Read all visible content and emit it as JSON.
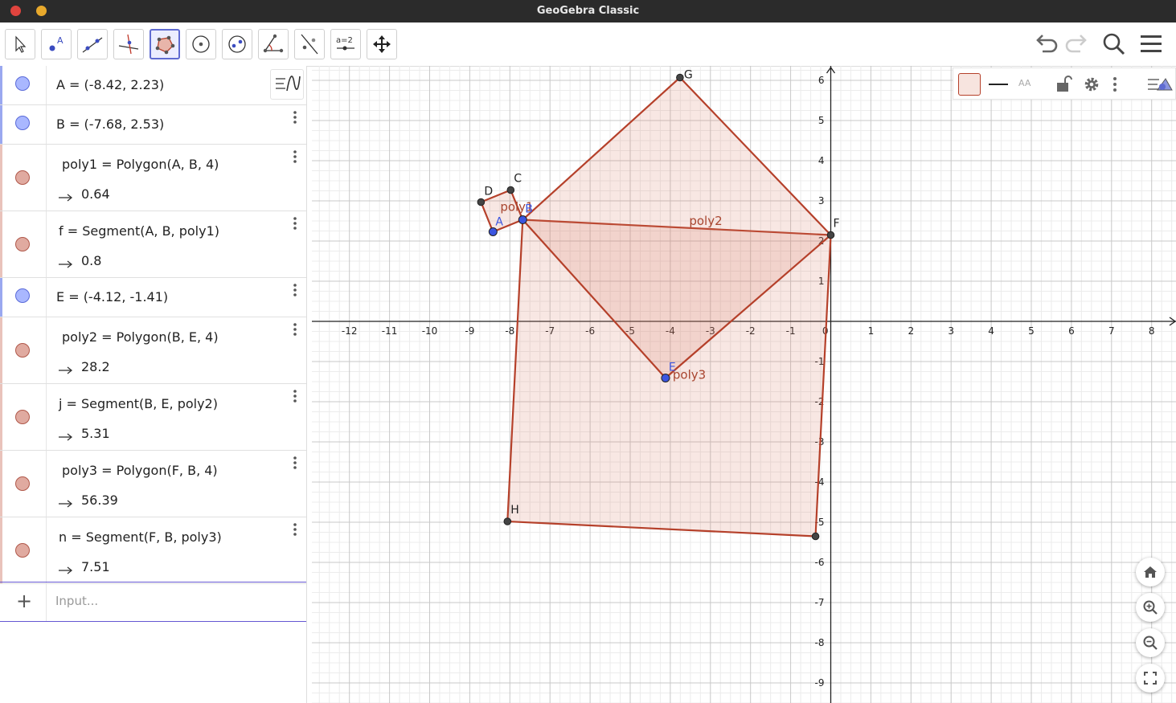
{
  "window": {
    "title": "GeoGebra Classic"
  },
  "toolbar": {
    "tools": [
      {
        "name": "move-tool",
        "selected": false
      },
      {
        "name": "point-tool",
        "selected": false
      },
      {
        "name": "line-tool",
        "selected": false
      },
      {
        "name": "perpendicular-line-tool",
        "selected": false
      },
      {
        "name": "polygon-tool",
        "selected": true
      },
      {
        "name": "circle-tool",
        "selected": false
      },
      {
        "name": "ellipse-tool",
        "selected": false
      },
      {
        "name": "angle-tool",
        "selected": false
      },
      {
        "name": "reflect-tool",
        "selected": false
      },
      {
        "name": "slider-tool",
        "selected": false
      },
      {
        "name": "move-graphics-tool",
        "selected": false
      }
    ],
    "slider_label": "a=2"
  },
  "algebra": {
    "items": [
      {
        "def": "A = (-8.42, 2.23)",
        "color": "blue"
      },
      {
        "def": "B = (-7.68, 2.53)",
        "color": "blue"
      },
      {
        "def": "poly1 = Polygon(A, B, 4)",
        "value": "0.64",
        "color": "red"
      },
      {
        "def": "f = Segment(A, B, poly1)",
        "value": "0.8",
        "color": "red"
      },
      {
        "def": "E = (-4.12, -1.41)",
        "color": "blue"
      },
      {
        "def": "poly2 = Polygon(B, E, 4)",
        "value": "28.2",
        "color": "red"
      },
      {
        "def": "j = Segment(B, E, poly2)",
        "value": "5.31",
        "color": "red"
      },
      {
        "def": "poly3 = Polygon(F, B, 4)",
        "value": "56.39",
        "color": "red"
      },
      {
        "def": "n = Segment(F, B, poly3)",
        "value": "7.51",
        "color": "red"
      }
    ],
    "input_placeholder": "Input..."
  },
  "graphics": {
    "x_ticks": [
      "-12",
      "-11",
      "-10",
      "-9",
      "-8",
      "-7",
      "-6",
      "-5",
      "-4",
      "-3",
      "-2",
      "-1",
      "0",
      "1",
      "2",
      "3",
      "4",
      "5",
      "6",
      "7",
      "8"
    ],
    "y_ticks": [
      "6",
      "5",
      "4",
      "3",
      "2",
      "1",
      "-1",
      "-2",
      "-3",
      "-4",
      "-5",
      "-6",
      "-7",
      "-8",
      "-9"
    ],
    "points": {
      "A": [
        -8.42,
        2.23
      ],
      "B": [
        -7.68,
        2.53
      ],
      "C": [
        -7.98,
        3.27
      ],
      "D": [
        -8.72,
        2.97
      ],
      "E": [
        -4.12,
        -1.41
      ],
      "F": [
        0.0,
        2.15
      ],
      "G": [
        -3.76,
        6.07
      ],
      "H": [
        -8.06,
        -4.98
      ],
      "I": [
        -0.38,
        -5.35
      ]
    },
    "point_labels": [
      "A",
      "B",
      "C",
      "D",
      "E",
      "F",
      "G",
      "H"
    ],
    "polygon_labels": [
      "poly1",
      "poly2",
      "poly3"
    ],
    "colors": {
      "polygon_stroke": "#b5402a",
      "polygon_fill": "#d97a66",
      "free_point": "#3b55e0",
      "dependent_point": "#444444",
      "axes": "#222222",
      "grid_major": "#c8c8c8",
      "grid_minor": "#ececec"
    }
  },
  "stylebar": {
    "text_size_label": "AA"
  }
}
